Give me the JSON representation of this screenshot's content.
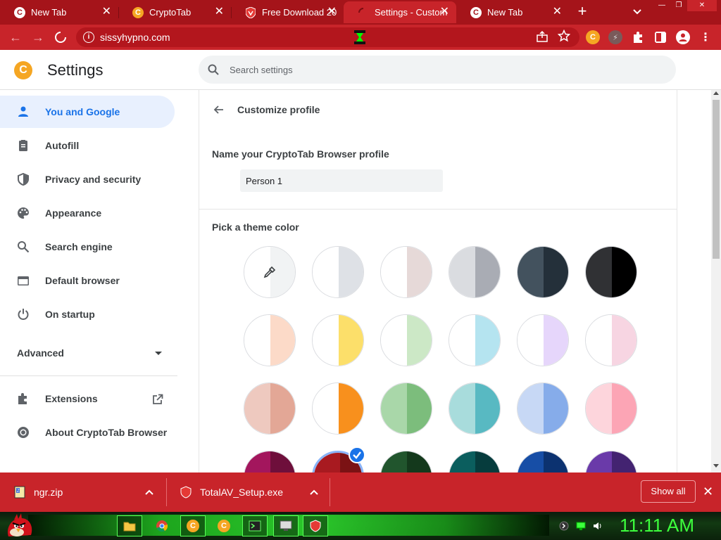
{
  "tabs": [
    {
      "title": "New Tab",
      "favicon": "chrome-c-icon",
      "active": false
    },
    {
      "title": "CryptoTab",
      "favicon": "cryptotab-icon",
      "active": false
    },
    {
      "title": "Free Download 20",
      "favicon": "shield-icon",
      "active": false
    },
    {
      "title": "Settings - Custom",
      "favicon": "loading-spinner-icon",
      "active": true
    },
    {
      "title": "New Tab",
      "favicon": "chrome-c-icon",
      "active": false
    }
  ],
  "tab_close_glyph": "✕",
  "new_tab_glyph": "+",
  "tab_search_glyph": "⌄",
  "window_controls": {
    "minimize": "—",
    "restore": "❐",
    "close": "✕"
  },
  "toolbar": {
    "back_glyph": "←",
    "forward_glyph": "→",
    "url": "sissyhypno.com",
    "info_glyph": "i"
  },
  "settings": {
    "logo_glyph": "C",
    "title": "Settings",
    "search_placeholder": "Search settings"
  },
  "sidebar": {
    "items": [
      {
        "label": "You and Google",
        "icon": "person-icon",
        "active": true
      },
      {
        "label": "Autofill",
        "icon": "clipboard-icon"
      },
      {
        "label": "Privacy and security",
        "icon": "shield-icon"
      },
      {
        "label": "Appearance",
        "icon": "palette-icon"
      },
      {
        "label": "Search engine",
        "icon": "search-icon"
      },
      {
        "label": "Default browser",
        "icon": "browser-window-icon"
      },
      {
        "label": "On startup",
        "icon": "power-icon"
      }
    ],
    "advanced_label": "Advanced",
    "extensions_label": "Extensions",
    "about_label": "About CryptoTab Browser"
  },
  "profile": {
    "page_title": "Customize profile",
    "name_label": "Name your CryptoTab Browser profile",
    "name_value": "Person 1",
    "theme_label": "Pick a theme color",
    "swatches": [
      {
        "left": "#ffffff",
        "right": "#f1f3f4",
        "icon": "eyedropper-icon"
      },
      {
        "left": "#ffffff",
        "right": "#dee1e6"
      },
      {
        "left": "#ffffff",
        "right": "#e6d9d8"
      },
      {
        "left": "#dadce0",
        "right": "#a9acb4"
      },
      {
        "left": "#43525e",
        "right": "#24303a"
      },
      {
        "left": "#303134",
        "right": "#000000"
      },
      {
        "left": "#ffffff",
        "right": "#fcdac8"
      },
      {
        "left": "#ffffff",
        "right": "#fcdf6a"
      },
      {
        "left": "#ffffff",
        "right": "#cce8c6"
      },
      {
        "left": "#ffffff",
        "right": "#b5e4f0"
      },
      {
        "left": "#ffffff",
        "right": "#e6d6fb"
      },
      {
        "left": "#ffffff",
        "right": "#f7d5e2"
      },
      {
        "left": "#eec9bf",
        "right": "#e3a796"
      },
      {
        "left": "#ffffff",
        "right": "#f8901d"
      },
      {
        "left": "#a9d7a9",
        "right": "#7cbd7c"
      },
      {
        "left": "#a8dcdc",
        "right": "#58b9c2"
      },
      {
        "left": "#c7d8f5",
        "right": "#86acea"
      },
      {
        "left": "#fdd5dc",
        "right": "#fca5b5"
      },
      {
        "left": "#a3165d",
        "right": "#6e0f3b"
      },
      {
        "left": "#a81a20",
        "right": "#7b1214",
        "selected": true
      },
      {
        "left": "#21552d",
        "right": "#14391c"
      },
      {
        "left": "#0b5e5e",
        "right": "#063c3d"
      },
      {
        "left": "#174ea6",
        "right": "#0c3270"
      },
      {
        "left": "#6a3aa9",
        "right": "#432371"
      }
    ]
  },
  "downloads": {
    "items": [
      {
        "name": "ngr.zip",
        "icon": "zip-file-icon"
      },
      {
        "name": "TotalAV_Setup.exe",
        "icon": "totalav-shield-icon"
      }
    ],
    "show_all_label": "Show all",
    "close_glyph": "✕"
  },
  "taskbar": {
    "clock": "11:11 AM",
    "apps": [
      "file-explorer-icon",
      "chrome-icon",
      "cryptotab-icon",
      "cryptotab-icon",
      "terminal-icon",
      "remote-desktop-icon",
      "totalav-icon"
    ]
  },
  "colors": {
    "tab_strip": "#a5141a",
    "toolbar": "#c8242a",
    "accent_blue": "#1a73e8",
    "taskbar_green": "#3dff3d"
  }
}
